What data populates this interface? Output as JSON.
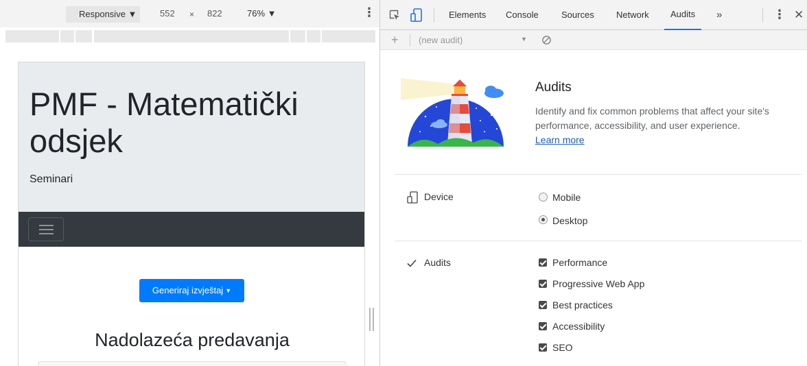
{
  "device_toolbar": {
    "device_mode": "Responsive ▼",
    "width": "552",
    "times": "×",
    "height": "822",
    "zoom": "76% ▼",
    "more": "⋮"
  },
  "page": {
    "site_title": "PMF - Matematički odsjek",
    "site_subtitle": "Seminari",
    "report_button": "Generiraj izvještaj",
    "report_button_caret": "▼",
    "lectures_heading": "Nadolazeća predavanja"
  },
  "devtools": {
    "tabs": [
      "Elements",
      "Console",
      "Sources",
      "Network",
      "Audits"
    ],
    "active_tab": "Audits",
    "overflow": "»",
    "menu": "⋮",
    "close": "✕"
  },
  "audits_toolbar": {
    "add": "+",
    "select_placeholder": "(new audit)",
    "select_caret": "▼"
  },
  "audits_panel": {
    "title": "Audits",
    "description": "Identify and fix common problems that affect your site's performance, accessibility, and user experience.",
    "learn_more": "Learn more",
    "device_section": {
      "label": "Device",
      "options": [
        {
          "label": "Mobile",
          "selected": false
        },
        {
          "label": "Desktop",
          "selected": true
        }
      ]
    },
    "audits_section": {
      "label": "Audits",
      "icon": "check-icon",
      "options": [
        {
          "label": "Performance",
          "checked": true
        },
        {
          "label": "Progressive Web App",
          "checked": true
        },
        {
          "label": "Best practices",
          "checked": true
        },
        {
          "label": "Accessibility",
          "checked": true
        },
        {
          "label": "SEO",
          "checked": true
        }
      ]
    }
  },
  "colors": {
    "primary_button": "#007bff",
    "navbar": "#343a40",
    "jumbotron": "#e9ecef",
    "active_tab_underline": "#1a73e8"
  }
}
